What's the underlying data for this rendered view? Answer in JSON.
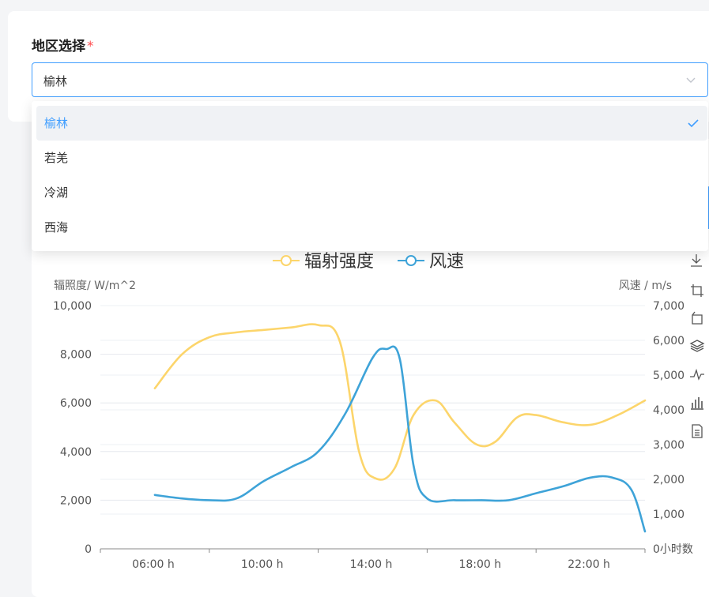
{
  "form": {
    "region_label": "地区选择",
    "required_mark": "*",
    "selected_value": "榆林",
    "options": [
      "榆林",
      "若羌",
      "冷湖",
      "西海"
    ]
  },
  "colors": {
    "accent": "#409eff",
    "irradiance": "#fcd56b",
    "wind": "#3ea3d8",
    "required": "#ff4d4f"
  },
  "toolbox": [
    "download-icon",
    "zoom-icon",
    "zoom-reset-icon",
    "stack-icon",
    "line-switch-icon",
    "bar-switch-icon",
    "data-view-icon"
  ],
  "chart_data": {
    "type": "line",
    "legend": [
      "辐射强度",
      "风速"
    ],
    "legend_position": "top-center",
    "y_left_label": "辐照度/ W/m^2",
    "y_right_label": "风速 / m/s",
    "x_axis_name": "小时数",
    "y_left_ticks": [
      "10,000",
      "8,000",
      "6,000",
      "4,000",
      "2,000",
      "0"
    ],
    "y_right_ticks": [
      "7,000",
      "6,000",
      "5,000",
      "4,000",
      "3,000",
      "2,000",
      "1,000",
      "0"
    ],
    "x_ticks": [
      "06:00 h",
      "10:00 h",
      "14:00 h",
      "18:00 h",
      "22:00 h"
    ],
    "y_left_range": [
      0,
      10000
    ],
    "y_right_range": [
      0,
      7000
    ],
    "grid": true,
    "smooth": true,
    "series": [
      {
        "name": "辐射强度",
        "axis": "left",
        "x": [
          6,
          7,
          8,
          9,
          10,
          11,
          12,
          12.8,
          13.5,
          14.1,
          14.8,
          15.5,
          16.3,
          17,
          17.8,
          18.5,
          19.3,
          20,
          21,
          22,
          23,
          24
        ],
        "values": [
          6600,
          8000,
          8700,
          8900,
          9000,
          9100,
          9200,
          8500,
          4000,
          2900,
          3300,
          5500,
          6100,
          5200,
          4300,
          4400,
          5400,
          5500,
          5200,
          5100,
          5500,
          6100
        ]
      },
      {
        "name": "风速",
        "axis": "right",
        "x": [
          6,
          7,
          8,
          9,
          10,
          11,
          12,
          13,
          14,
          14.5,
          15,
          15.5,
          16,
          17,
          18,
          19,
          20,
          21,
          22,
          22.8,
          23.5,
          24
        ],
        "values": [
          1550,
          1450,
          1400,
          1450,
          1950,
          2350,
          2800,
          3900,
          5500,
          5750,
          5450,
          2400,
          1450,
          1400,
          1400,
          1400,
          1600,
          1800,
          2050,
          2050,
          1700,
          500
        ]
      }
    ]
  }
}
